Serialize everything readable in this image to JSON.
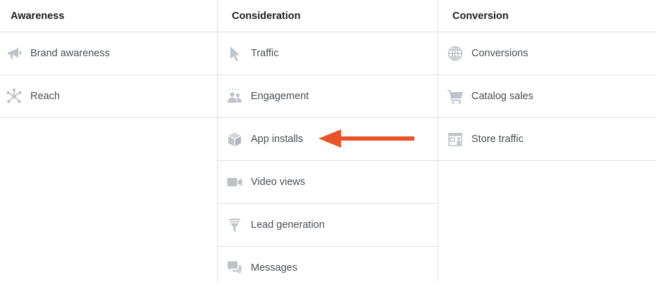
{
  "columns": [
    {
      "title": "Awareness",
      "items": [
        {
          "label": "Brand awareness",
          "icon": "megaphone-icon"
        },
        {
          "label": "Reach",
          "icon": "reach-icon"
        }
      ]
    },
    {
      "title": "Consideration",
      "items": [
        {
          "label": "Traffic",
          "icon": "cursor-icon"
        },
        {
          "label": "Engagement",
          "icon": "people-icon"
        },
        {
          "label": "App installs",
          "icon": "box-icon"
        },
        {
          "label": "Video views",
          "icon": "video-camera-icon"
        },
        {
          "label": "Lead generation",
          "icon": "funnel-icon"
        },
        {
          "label": "Messages",
          "icon": "chat-bubbles-icon"
        }
      ]
    },
    {
      "title": "Conversion",
      "items": [
        {
          "label": "Conversions",
          "icon": "globe-icon"
        },
        {
          "label": "Catalog sales",
          "icon": "shopping-cart-icon"
        },
        {
          "label": "Store traffic",
          "icon": "store-icon"
        }
      ]
    }
  ],
  "colors": {
    "icon": "#bec3c9",
    "divider": "#dddfe2",
    "label": "#4b4f56",
    "heading": "#1c1e21",
    "annotation_arrow": "#e9532a"
  }
}
